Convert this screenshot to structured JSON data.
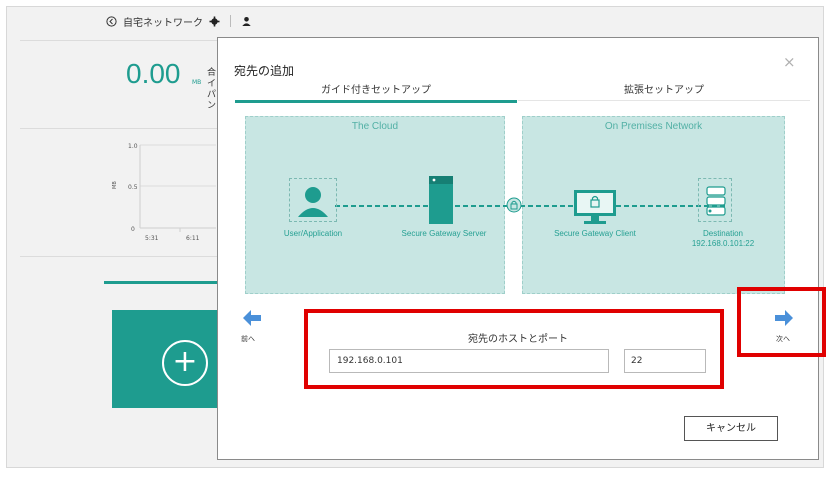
{
  "background_app": {
    "network_name": "自宅ネットワーク",
    "stat_value": "0.00",
    "stat_unit": "MB",
    "stat_side_text": "合イパン",
    "chart_ylabel": "MB",
    "chart_yticks": [
      "1.0",
      "0.5",
      "0"
    ],
    "chart_xticks": [
      "5:31",
      "6:11"
    ],
    "add_symbol": "+"
  },
  "dialog": {
    "title": "宛先の追加",
    "close_symbol": "×",
    "tabs": [
      {
        "label": "ガイド付きセットアップ",
        "active": true
      },
      {
        "label": "拡張セットアップ",
        "active": false
      }
    ],
    "cloud_panel": {
      "title": "The Cloud",
      "nodes": [
        {
          "label": "User/Application",
          "icon": "user-icon"
        },
        {
          "label": "Secure Gateway Server",
          "icon": "server-icon"
        }
      ]
    },
    "onprem_panel": {
      "title": "On Premises Network",
      "nodes": [
        {
          "label": "Secure Gateway Client",
          "icon": "monitor-lock-icon"
        },
        {
          "label": "Destination",
          "sublabel": "192.168.0.101:22",
          "icon": "database-icon"
        }
      ]
    },
    "prev_label": "前へ",
    "next_label": "次へ",
    "host_caption": "宛先のホストとポート",
    "host_value": "192.168.0.101",
    "port_value": "22",
    "cancel_label": "キャンセル"
  },
  "colors": {
    "teal": "#1e9c8f",
    "panel": "#c8e6e3",
    "arrow": "#4a90d9",
    "highlight": "#e00000"
  }
}
